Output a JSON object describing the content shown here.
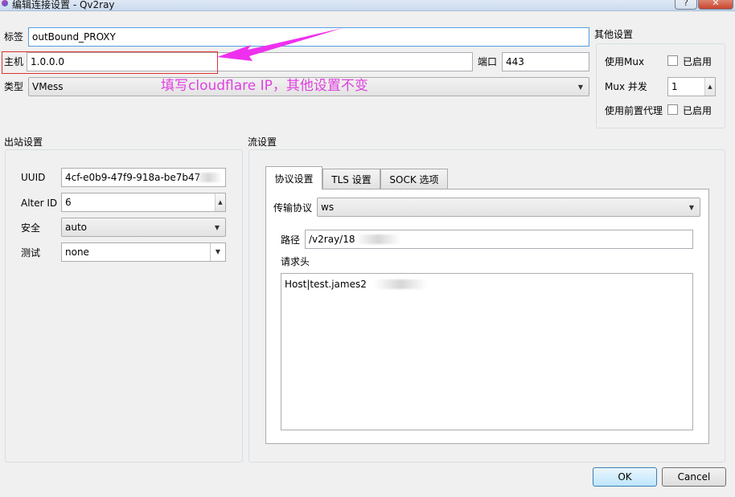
{
  "window": {
    "title": "编辑连接设置 - Qv2ray",
    "help": "?",
    "close": "✕"
  },
  "connection": {
    "tag_label": "标签",
    "tag_value": "outBound_PROXY",
    "host_label": "主机",
    "host_value": "1.0.0.0",
    "port_label": "端口",
    "port_value": "443",
    "type_label": "类型",
    "type_value": "VMess"
  },
  "other": {
    "title": "其他设置",
    "mux_label": "使用Mux",
    "mux_check_label": "已启用",
    "mux_concurrency_label": "Mux 并发",
    "mux_concurrency_value": "1",
    "proxy_label": "使用前置代理",
    "proxy_check_label": "已启用"
  },
  "outbound": {
    "title": "出站设置",
    "uuid_label": "UUID",
    "uuid_value": "4cf-e0b9-47f9-918a-be7b47",
    "alterid_label": "Alter ID",
    "alterid_value": "6",
    "security_label": "安全",
    "security_value": "auto",
    "test_label": "测试",
    "test_value": "none"
  },
  "stream": {
    "title": "流设置",
    "tabs": [
      {
        "label": "协议设置"
      },
      {
        "label": "TLS 设置"
      },
      {
        "label": "SOCK 选项"
      }
    ],
    "protocol_label": "传输协议",
    "protocol_value": "ws",
    "path_label": "路径",
    "path_value": "/v2ray/18",
    "headers_label": "请求头",
    "headers_value": "Host|test.james2"
  },
  "buttons": {
    "ok": "OK",
    "cancel": "Cancel"
  },
  "annotation": {
    "text": "填写cloudflare IP，其他设置不变",
    "color": "#e040e0"
  }
}
